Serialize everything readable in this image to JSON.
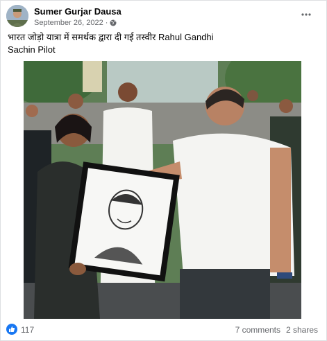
{
  "post": {
    "author": "Sumer Gurjar Dausa",
    "date": "September 26, 2022",
    "separator": "·",
    "privacy_icon": "globe-icon",
    "menu_icon": "more-horizontal-icon",
    "caption_hindi": "भारत जोड़ो यात्रा में समर्थक द्वारा दी गई तस्वीर",
    "caption_name_1": "Rahul Gandhi",
    "caption_name_2": "Sachin Pilot"
  },
  "footer": {
    "reaction_icon": "like-icon",
    "like_count": "117",
    "comments": "7 comments",
    "shares": "2 shares"
  },
  "colors": {
    "brand_blue": "#1877f2",
    "secondary_text": "#65676b",
    "border": "#dddfe2"
  }
}
